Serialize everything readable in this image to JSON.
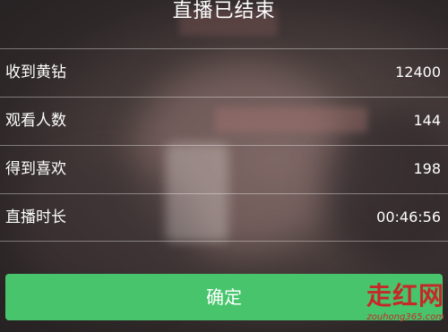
{
  "title": "直播已结束",
  "stats": [
    {
      "label": "收到黄钻",
      "value": "12400"
    },
    {
      "label": "观看人数",
      "value": "144"
    },
    {
      "label": "得到喜欢",
      "value": "198"
    },
    {
      "label": "直播时长",
      "value": "00:46:56"
    }
  ],
  "confirm_button": {
    "label": "确定",
    "color": "#48c56c"
  },
  "watermark": {
    "main": "走红网",
    "sub": "zouhong365.com",
    "color": "#c62828"
  }
}
